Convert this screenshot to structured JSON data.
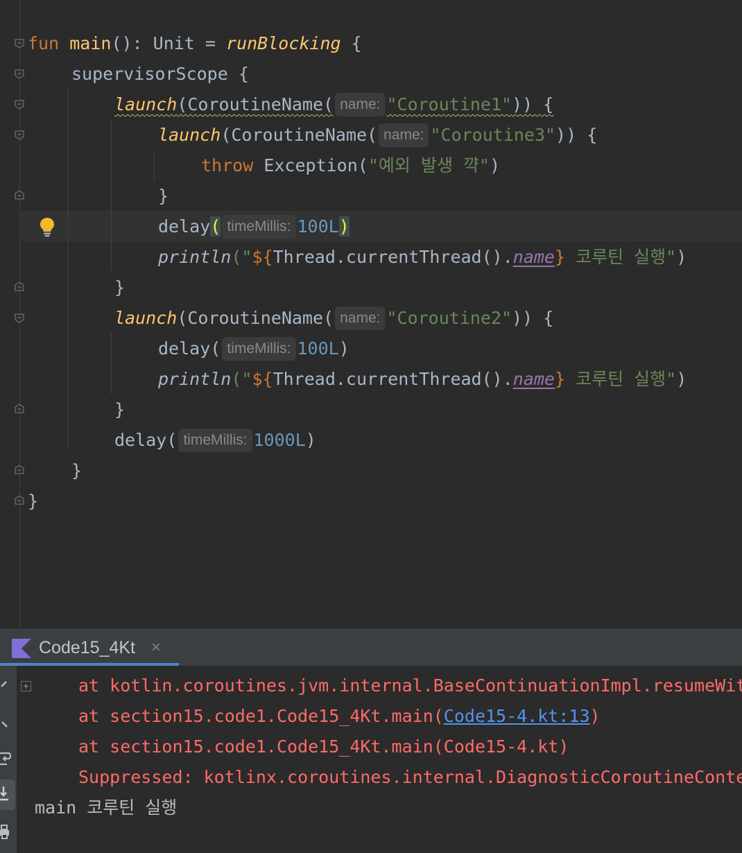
{
  "editor": {
    "code": {
      "l1": {
        "kw_fun": "fun",
        "fn_main": "main",
        "sig": "(): Unit = ",
        "run_blocking": "runBlocking",
        "brace": " {"
      },
      "l2": {
        "text": "supervisorScope {"
      },
      "l3": {
        "launch": "launch",
        "open": "(CoroutineName(",
        "hint": "name:",
        "str": "\"Coroutine1\"",
        "close": ")) {"
      },
      "l4": {
        "launch": "launch",
        "open": "(CoroutineName(",
        "hint": "name:",
        "str": "\"Coroutine3\"",
        "close": ")) {"
      },
      "l5": {
        "kw_throw": "throw",
        "call": " Exception(",
        "str": "\"예외 발생 꺅\"",
        "close": ")"
      },
      "l6": {
        "text": "}"
      },
      "l7": {
        "fn": "delay",
        "open": "(",
        "hint": "timeMillis:",
        "num": "100L",
        "close": ")"
      },
      "l8": {
        "println": "println",
        "q_open": "(\"",
        "tmpl_open": "${",
        "expr": "Thread.currentThread().",
        "prop": "name",
        "tmpl_close": "}",
        "str": " 코루틴 실행\"",
        "close": ")"
      },
      "l9": {
        "text": "}"
      },
      "l10": {
        "launch": "launch",
        "open": "(CoroutineName(",
        "hint": "name:",
        "str": "\"Coroutine2\"",
        "close": ")) {"
      },
      "l11": {
        "fn": "delay",
        "open": "(",
        "hint": "timeMillis:",
        "num": "100L",
        "close": ")"
      },
      "l12": {
        "println": "println",
        "q_open": "(\"",
        "tmpl_open": "${",
        "expr": "Thread.currentThread().",
        "prop": "name",
        "tmpl_close": "}",
        "str": " 코루틴 실행\"",
        "close": ")"
      },
      "l13": {
        "text": "}"
      },
      "l14": {
        "fn": "delay",
        "open": "(",
        "hint": "timeMillis:",
        "num": "1000L",
        "close": ")"
      },
      "l15": {
        "text": "}"
      },
      "l16": {
        "text": "}"
      }
    }
  },
  "run_panel": {
    "tab_label": "Code15_4Kt",
    "close_glyph": "×",
    "console": {
      "line1": "at kotlin.coroutines.jvm.internal.BaseContinuationImpl.resumeWith",
      "line2_prefix": "at section15.code1.Code15_4Kt.main(",
      "line2_link": "Code15-4.kt:13",
      "line2_suffix": ")",
      "line3": "at section15.code1.Code15_4Kt.main(Code15-4.kt)",
      "line4": "Suppressed: kotlinx.coroutines.internal.DiagnosticCoroutineContextException",
      "line5": "main 코루틴 실행"
    }
  },
  "colors": {
    "keyword": "#cc7832",
    "function": "#ffc66d",
    "string": "#6a8759",
    "number": "#6897bb",
    "property": "#9876aa",
    "error_text": "#ff6b68",
    "link": "#5394ec",
    "background": "#2b2b2b"
  }
}
